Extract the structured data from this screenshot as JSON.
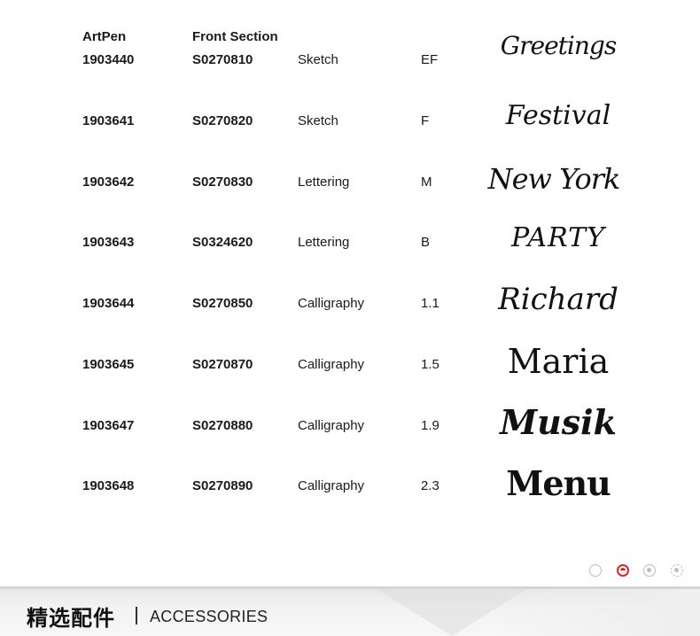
{
  "headers": {
    "artpen": "ArtPen",
    "front_section": "Front Section"
  },
  "rows": [
    {
      "artpen": "1903440",
      "front": "S0270810",
      "type": "Sketch",
      "nib": "EF",
      "sample": "Greetings"
    },
    {
      "artpen": "1903641",
      "front": "S0270820",
      "type": "Sketch",
      "nib": "F",
      "sample": "Festival"
    },
    {
      "artpen": "1903642",
      "front": "S0270830",
      "type": "Lettering",
      "nib": "M",
      "sample": "New York"
    },
    {
      "artpen": "1903643",
      "front": "S0324620",
      "type": "Lettering",
      "nib": "B",
      "sample": "PARTY"
    },
    {
      "artpen": "1903644",
      "front": "S0270850",
      "type": "Calligraphy",
      "nib": "1.1",
      "sample": "Richard"
    },
    {
      "artpen": "1903645",
      "front": "S0270870",
      "type": "Calligraphy",
      "nib": "1.5",
      "sample": "Maria"
    },
    {
      "artpen": "1903647",
      "front": "S0270880",
      "type": "Calligraphy",
      "nib": "1.9",
      "sample": "Musik"
    },
    {
      "artpen": "1903648",
      "front": "S0270890",
      "type": "Calligraphy",
      "nib": "2.3",
      "sample": "Menu"
    }
  ],
  "pagination": {
    "active_color": "#d9262c",
    "inactive_color": "#bdbdbd"
  },
  "footer": {
    "title_cn": "精选配件",
    "title_en": "ACCESSORIES"
  }
}
